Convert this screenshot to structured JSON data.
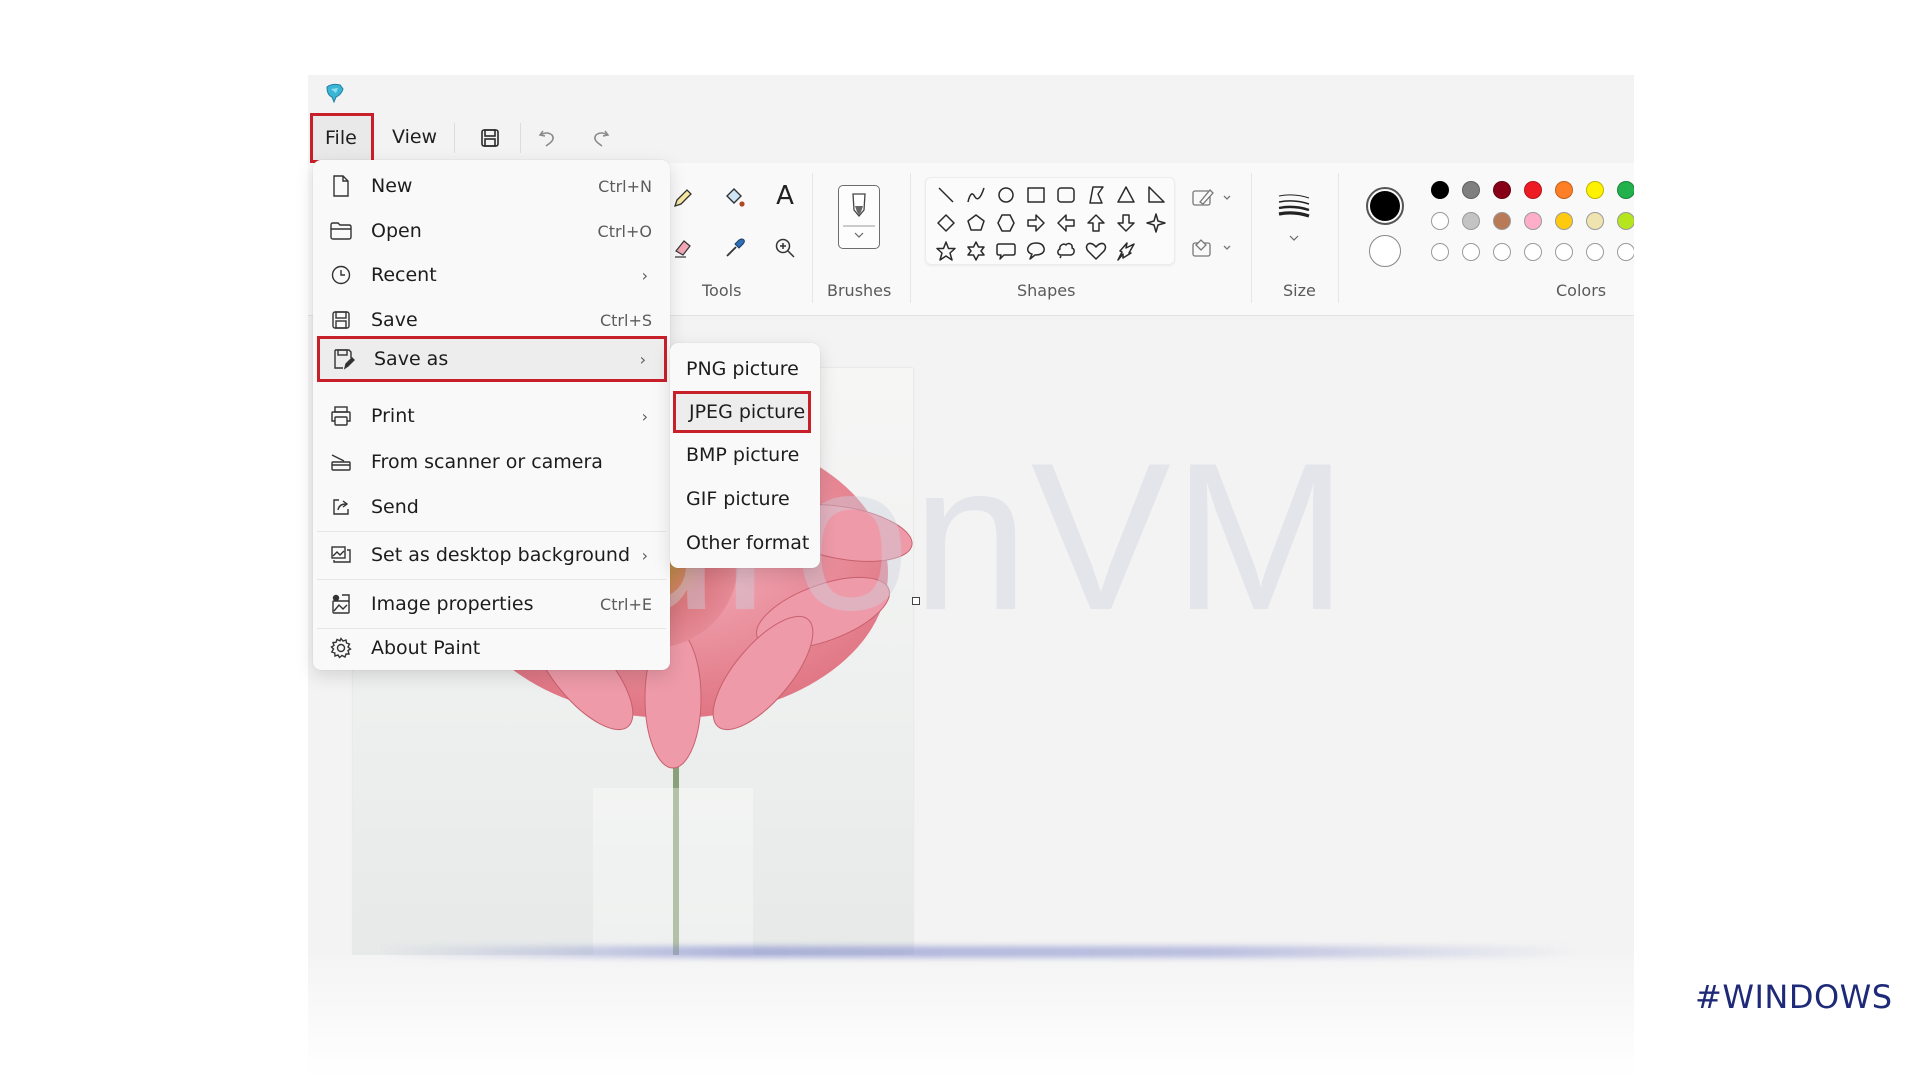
{
  "app": {
    "title_icon": "paint-app-icon"
  },
  "menubar": {
    "file_label": "File",
    "view_label": "View",
    "quick_access": [
      {
        "name": "save-icon"
      },
      {
        "name": "undo-icon"
      },
      {
        "name": "redo-icon"
      }
    ]
  },
  "ribbon": {
    "groups": {
      "tools": "Tools",
      "brushes": "Brushes",
      "shapes": "Shapes",
      "size": "Size",
      "colors": "Colors"
    },
    "tools": [
      "pencil-icon",
      "fill-icon",
      "text-icon",
      "eraser-icon",
      "color-picker-icon",
      "magnifier-icon"
    ],
    "shapes": [
      "line",
      "curve",
      "oval",
      "rectangle",
      "rounded-rectangle",
      "polygon",
      "triangle",
      "right-triangle",
      "diamond",
      "pentagon",
      "hexagon",
      "right-arrow",
      "left-arrow",
      "up-arrow",
      "down-arrow",
      "four-point-star",
      "five-point-star",
      "six-point-star",
      "rounded-callout",
      "oval-callout",
      "cloud-callout",
      "heart",
      "lightning"
    ],
    "outline_label": "outline-icon",
    "fill_label": "fill-shape-icon",
    "colors": {
      "primary": "#000000",
      "secondary": "#ffffff",
      "palette_row1": [
        "#000000",
        "#7f7f7f",
        "#880015",
        "#ed1c24",
        "#ff7f27",
        "#fff200",
        "#22b14c"
      ],
      "palette_row2": [
        "#ffffff",
        "#c3c3c3",
        "#b97a57",
        "#ffaec9",
        "#ffc90e",
        "#efe4b0",
        "#b5e61d"
      ],
      "palette_row3": [
        "#ffffff",
        "#ffffff",
        "#ffffff",
        "#ffffff",
        "#ffffff",
        "#ffffff",
        "#ffffff"
      ]
    }
  },
  "file_menu": {
    "items": [
      {
        "label": "New",
        "shortcut": "Ctrl+N",
        "icon": "new-file-icon"
      },
      {
        "label": "Open",
        "shortcut": "Ctrl+O",
        "icon": "folder-icon"
      },
      {
        "label": "Recent",
        "shortcut": "",
        "icon": "clock-icon",
        "submenu": true
      },
      {
        "label": "Save",
        "shortcut": "Ctrl+S",
        "icon": "save-icon"
      },
      {
        "label": "Save as",
        "shortcut": "",
        "icon": "save-as-icon",
        "submenu": true,
        "highlighted": true
      },
      {
        "label": "Print",
        "shortcut": "",
        "icon": "printer-icon",
        "submenu": true
      },
      {
        "label": "From scanner or camera",
        "shortcut": "",
        "icon": "scanner-icon"
      },
      {
        "label": "Send",
        "shortcut": "",
        "icon": "share-icon"
      },
      {
        "label": "Set as desktop background",
        "shortcut": "",
        "icon": "desktop-background-icon",
        "submenu": true
      },
      {
        "label": "Image properties",
        "shortcut": "Ctrl+E",
        "icon": "image-properties-icon"
      },
      {
        "label": "About Paint",
        "shortcut": "",
        "icon": "gear-icon"
      }
    ]
  },
  "save_as_submenu": {
    "items": [
      "PNG picture",
      "JPEG picture",
      "BMP picture",
      "GIF picture",
      "Other format"
    ],
    "highlighted": "JPEG picture"
  },
  "highlight_color": "#c8202b",
  "watermark": "NeuronVM",
  "hashtag": "#WINDOWS"
}
